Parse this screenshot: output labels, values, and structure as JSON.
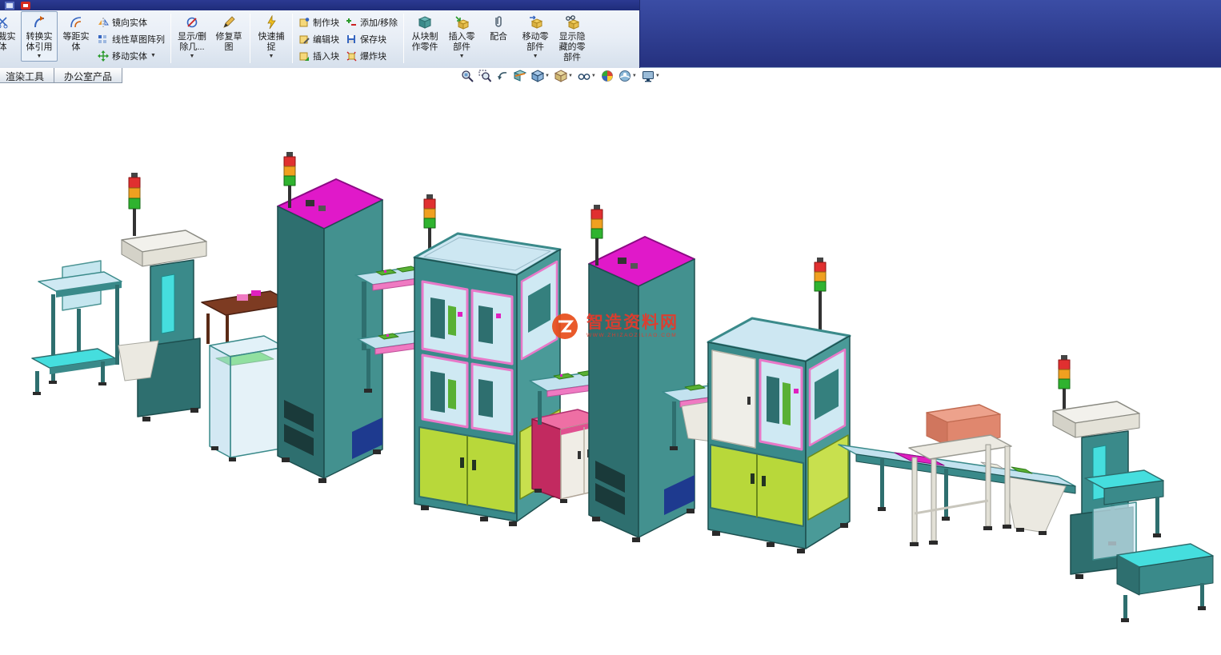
{
  "ribbon": {
    "trim": {
      "label": "剪裁实体"
    },
    "convert_entities": {
      "label": "转换实体引用"
    },
    "offset_entities": {
      "label": "等距实体"
    },
    "sketch_tools": [
      {
        "label": "镜向实体"
      },
      {
        "label": "线性草图阵列"
      },
      {
        "label": "移动实体"
      }
    ],
    "display_delete_relations": {
      "label": "显示/删除几..."
    },
    "repair_sketch": {
      "label": "修复草图"
    },
    "quick_snaps": {
      "label": "快速捕捉"
    },
    "block_tools_a": [
      {
        "label": "制作块"
      },
      {
        "label": "编辑块"
      },
      {
        "label": "插入块"
      }
    ],
    "block_tools_b": [
      {
        "label": "添加/移除"
      },
      {
        "label": "保存块"
      },
      {
        "label": "爆炸块"
      }
    ],
    "make_part_from_block": {
      "label": "从块制作零件"
    },
    "insert_components": {
      "label": "插入零部件"
    },
    "mate": {
      "label": "配合"
    },
    "move_component": {
      "label": "移动零部件"
    },
    "show_hidden_components": {
      "label": "显示隐藏的零部件"
    }
  },
  "tabs": [
    {
      "label": "渲染工具"
    },
    {
      "label": "办公室产品"
    }
  ],
  "hud_icons": [
    "zoom-to-fit",
    "zoom-to-area",
    "previous-view",
    "section-view",
    "view-orientation",
    "display-style",
    "hide-show-items",
    "edit-appearance",
    "apply-scene",
    "view-settings"
  ],
  "watermark": {
    "title": "智造资料网",
    "subtitle": "WWW.ZHIZAOZILIAO.COM"
  },
  "palette": {
    "header_navy": "#2c3b92",
    "ribbon_top": "#f4f7fb",
    "ribbon_bottom": "#d6e0ec",
    "machine_teal": "#3a8a8a",
    "machine_teal_dark": "#2e6f6f",
    "machine_teal_light": "#4a9a98",
    "magenta_top": "#e019c9",
    "glass_blue": "#cde7f2",
    "belt_cyan": "#45dede",
    "door_green": "#b8d83a",
    "door_green_side": "#c8e04e",
    "rail_pink": "#ef7ac2",
    "window_frame_pink": "#e878c8",
    "accent_navy": "#1e3a8f",
    "salmon_box": "#eda28c",
    "table_brown": "#7d3b22",
    "stack_light_red": "#e03030",
    "stack_light_amber": "#f0a020",
    "stack_light_green": "#2fb32f",
    "watermark_red": "#e8392a"
  }
}
